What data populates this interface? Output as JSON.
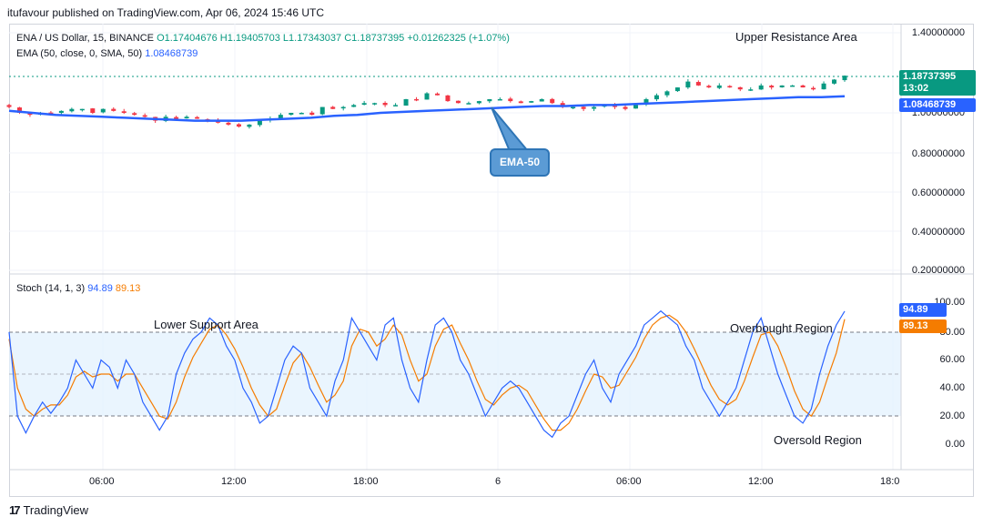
{
  "header": {
    "published": "itufavour published on TradingView.com, Apr 06, 2024 15:46 UTC"
  },
  "price_legend": {
    "symbol": "ENA / US Dollar, 15, BINANCE",
    "open": "O1.17404676",
    "high": "H1.19405703",
    "low": "L1.17343037",
    "close": "C1.18737395",
    "change": "+0.01262325 (+1.07%)"
  },
  "ema_legend": {
    "label": "EMA (50, close, 0, SMA, 50)",
    "value": "1.08468739"
  },
  "stoch_legend": {
    "label": "Stoch (14, 1, 3)",
    "k": "94.89",
    "d": "89.13"
  },
  "price_axis": {
    "ticks": [
      "1.40000000",
      "1.00000000",
      "0.80000000",
      "0.60000000",
      "0.40000000",
      "0.20000000"
    ]
  },
  "price_tags": {
    "last": "1.18737395",
    "countdown": "13:02",
    "ema": "1.08468739"
  },
  "stoch_axis": {
    "ticks": [
      "100.00",
      "80.00",
      "60.00",
      "40.00",
      "20.00",
      "0.00"
    ]
  },
  "stoch_tags": {
    "k": "94.89",
    "d": "89.13"
  },
  "time_axis": {
    "ticks": [
      "06:00",
      "12:00",
      "18:00",
      "6",
      "06:00",
      "12:00",
      "18:0"
    ]
  },
  "annotations": {
    "upper_resistance": "Upper Resistance Area",
    "lower_support": "Lower Support Area",
    "overbought": "Overbought Region",
    "oversold": "Oversold Region",
    "ema_callout": "EMA-50"
  },
  "footer": {
    "brand": "TradingView",
    "logo": "17"
  },
  "colors": {
    "up": "#089981",
    "down": "#f23645",
    "ema": "#2962ff",
    "stoch_k": "#2962ff",
    "stoch_d": "#f57c00",
    "band": "#e3f2fd"
  },
  "chart_data": [
    {
      "type": "candlestick",
      "symbol": "ENA / US Dollar",
      "interval": "15",
      "ylim": [
        0.2,
        1.4
      ],
      "last_close": 1.18737395,
      "ema_50_last": 1.08468739,
      "price_path": [
        1.03,
        1.0,
        0.99,
        1.0,
        1.0,
        1.01,
        1.02,
        1.02,
        1.0,
        1.02,
        1.01,
        1.0,
        0.99,
        0.98,
        0.96,
        0.98,
        0.97,
        0.98,
        0.97,
        0.96,
        0.95,
        0.94,
        0.93,
        0.94,
        0.96,
        0.97,
        0.99,
        1.0,
        1.0,
        0.99,
        1.03,
        1.02,
        1.03,
        1.04,
        1.05,
        1.05,
        1.04,
        1.04,
        1.07,
        1.07,
        1.1,
        1.09,
        1.06,
        1.05,
        1.05,
        1.06,
        1.07,
        1.07,
        1.06,
        1.05,
        1.06,
        1.07,
        1.05,
        1.03,
        1.03,
        1.02,
        1.03,
        1.04,
        1.03,
        1.02,
        1.04,
        1.07,
        1.09,
        1.11,
        1.13,
        1.16,
        1.14,
        1.13,
        1.14,
        1.13,
        1.12,
        1.12,
        1.14,
        1.13,
        1.14,
        1.14,
        1.13,
        1.12,
        1.15,
        1.17,
        1.19
      ],
      "ema_path": [
        1.01,
        1.0,
        0.99,
        0.985,
        0.98,
        0.975,
        0.97,
        0.965,
        0.96,
        0.96,
        0.96,
        0.965,
        0.97,
        0.975,
        0.985,
        0.99,
        1.0,
        1.005,
        1.01,
        1.015,
        1.02,
        1.025,
        1.03,
        1.035,
        1.035,
        1.04,
        1.04,
        1.045,
        1.05,
        1.055,
        1.06,
        1.065,
        1.07,
        1.075,
        1.08,
        1.08,
        1.085
      ],
      "annotations": [
        "Upper Resistance Area",
        "EMA-50"
      ]
    },
    {
      "type": "line",
      "name": "Stoch (14, 1, 3)",
      "ylim": [
        0,
        100
      ],
      "levels": [
        80,
        50,
        20
      ],
      "series": [
        {
          "name": "K",
          "values": [
            80,
            20,
            8,
            20,
            30,
            22,
            30,
            40,
            60,
            50,
            40,
            60,
            55,
            40,
            60,
            50,
            30,
            20,
            10,
            20,
            50,
            65,
            75,
            80,
            90,
            85,
            70,
            60,
            40,
            30,
            15,
            20,
            40,
            60,
            70,
            65,
            40,
            30,
            20,
            45,
            60,
            90,
            80,
            70,
            60,
            85,
            90,
            60,
            40,
            30,
            60,
            85,
            90,
            80,
            60,
            50,
            35,
            20,
            30,
            40,
            45,
            40,
            30,
            20,
            10,
            5,
            15,
            20,
            35,
            50,
            60,
            40,
            30,
            50,
            60,
            70,
            85,
            90,
            95,
            90,
            85,
            70,
            60,
            40,
            30,
            20,
            30,
            40,
            60,
            80,
            90,
            70,
            50,
            35,
            20,
            15,
            25,
            50,
            70,
            85,
            94.89
          ]
        },
        {
          "name": "D",
          "values": [
            75,
            40,
            25,
            20,
            25,
            28,
            28,
            35,
            48,
            52,
            48,
            50,
            50,
            45,
            50,
            50,
            40,
            30,
            20,
            18,
            30,
            48,
            62,
            72,
            82,
            85,
            78,
            68,
            55,
            40,
            28,
            20,
            25,
            42,
            58,
            65,
            55,
            42,
            30,
            35,
            45,
            70,
            82,
            80,
            70,
            75,
            85,
            78,
            60,
            45,
            50,
            70,
            82,
            85,
            72,
            60,
            45,
            32,
            28,
            35,
            40,
            42,
            38,
            28,
            18,
            10,
            10,
            15,
            25,
            38,
            50,
            48,
            40,
            42,
            52,
            62,
            75,
            85,
            90,
            92,
            88,
            80,
            68,
            55,
            42,
            32,
            28,
            32,
            45,
            62,
            78,
            80,
            70,
            55,
            38,
            25,
            20,
            30,
            48,
            65,
            89.13
          ]
        }
      ],
      "annotations": [
        "Lower Support Area",
        "Overbought Region",
        "Oversold Region"
      ]
    }
  ]
}
